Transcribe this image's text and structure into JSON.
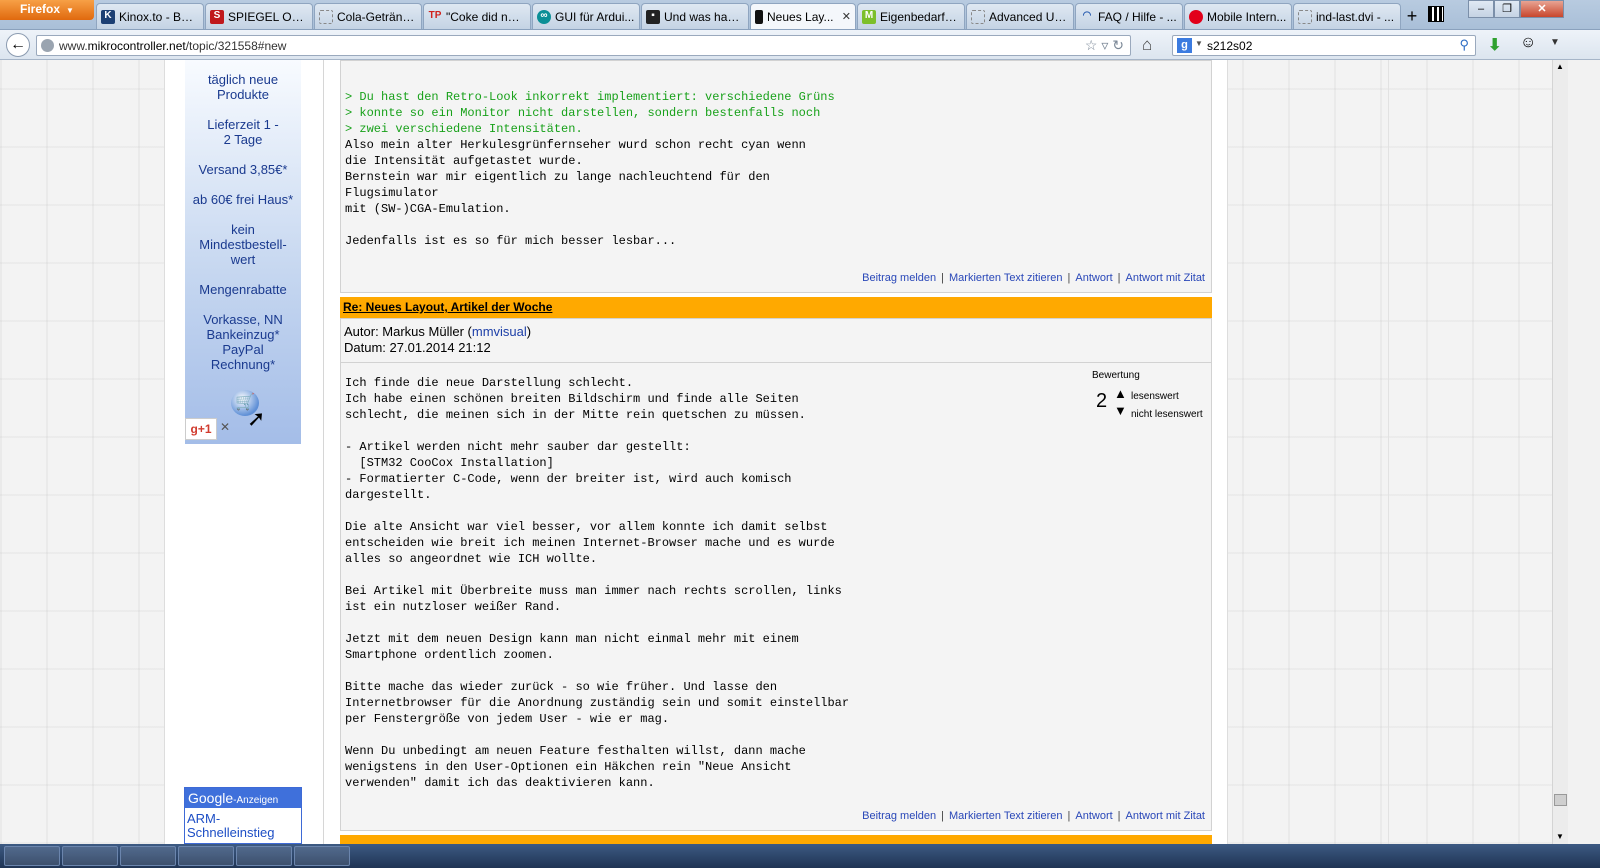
{
  "browser": {
    "menu_label": "Firefox",
    "tabs": [
      {
        "label": "Kinox.to - Bes...",
        "icon": "k"
      },
      {
        "label": "SPIEGEL ONLI...",
        "icon": "s"
      },
      {
        "label": "Cola-Getränk...",
        "icon": ""
      },
      {
        "label": "\"Coke did not...",
        "icon": "tp"
      },
      {
        "label": "GUI für Ardui...",
        "icon": "arduino"
      },
      {
        "label": "Und was hab i...",
        "icon": "monitor"
      },
      {
        "label": "Neues Lay...",
        "icon": "doc",
        "active": true
      },
      {
        "label": "Eigenbedarf n...",
        "icon": "m"
      },
      {
        "label": "Advanced Us...",
        "icon": ""
      },
      {
        "label": "FAQ / Hilfe - ...",
        "icon": "wave"
      },
      {
        "label": "Mobile Intern...",
        "icon": "vodafone"
      },
      {
        "label": "ind-last.dvi - ...",
        "icon": ""
      }
    ],
    "url_prefix": "www.",
    "url_domain": "mikrocontroller.net",
    "url_path": "/topic/321558#new",
    "search_value": "s212s02"
  },
  "sidebar": {
    "ad_lines": [
      "täglich neue Produkte",
      "Lieferzeit 1 - 2 Tage",
      "Versand 3,85€*",
      "ab 60€ frei Haus*",
      "kein Mindestbestell-wert",
      "Mengenrabatte",
      "Vorkasse, NN Bankeinzug* PayPal Rechnung*"
    ],
    "gplus_label": "g+1",
    "google_ads_brand": "Google",
    "google_ads_suffix": "-Anzeigen",
    "google_ads_link": "ARM-Schnelleinstieg"
  },
  "post1": {
    "quote": "> Du hast den Retro-Look inkorrekt implementiert: verschiedene Grüns\n> konnte so ein Monitor nicht darstellen, sondern bestenfalls noch\n> zwei verschiedene Intensitäten.",
    "body": "Also mein alter Herkulesgrünfernseher wurd schon recht cyan wenn\ndie Intensität aufgetastet wurde.\nBernstein war mir eigentlich zu lange nachleuchtend für den\nFlugsimulator\nmit (SW-)CGA-Emulation.\n\nJedenfalls ist es so für mich besser lesbar..."
  },
  "actions": {
    "report": "Beitrag melden",
    "quote_marked": "Markierten Text zitieren",
    "reply": "Antwort",
    "reply_quote": "Antwort mit Zitat"
  },
  "post2": {
    "title": "Re: Neues Layout, Artikel der Woche",
    "author_label": "Autor: Markus Müller (",
    "author_link": "mmvisual",
    "author_close": ")",
    "date": "Datum: 27.01.2014 21:12",
    "rating_label": "Bewertung",
    "rating_value": "2",
    "rating_up": "lesenswert",
    "rating_down": "nicht lesenswert",
    "body": "Ich finde die neue Darstellung schlecht.\nIch habe einen schönen breiten Bildschirm und finde alle Seiten\nschlecht, die meinen sich in der Mitte rein quetschen zu müssen.\n\n- Artikel werden nicht mehr sauber dar gestellt:\n  [STM32 CooCox Installation]\n- Formatierter C-Code, wenn der breiter ist, wird auch komisch\ndargestellt.\n\nDie alte Ansicht war viel besser, vor allem konnte ich damit selbst\nentscheiden wie breit ich meinen Internet-Browser mache und es wurde\nalles so angeordnet wie ICH wollte.\n\nBei Artikel mit Überbreite muss man immer nach rechts scrollen, links\nist ein nutzloser weißer Rand.\n\nJetzt mit dem neuen Design kann man nicht einmal mehr mit einem\nSmartphone ordentlich zoomen.\n\nBitte mache das wieder zurück - so wie früher. Und lasse den\nInternetbrowser für die Anordnung zuständig sein und somit einstellbar\nper Fenstergröße von jedem User - wie er mag.\n\nWenn Du unbedingt am neuen Feature festhalten willst, dann mache\nwenigstens in den User-Optionen ein Häkchen rein \"Neue Ansicht\nverwenden\" damit ich das deaktivieren kann."
  }
}
